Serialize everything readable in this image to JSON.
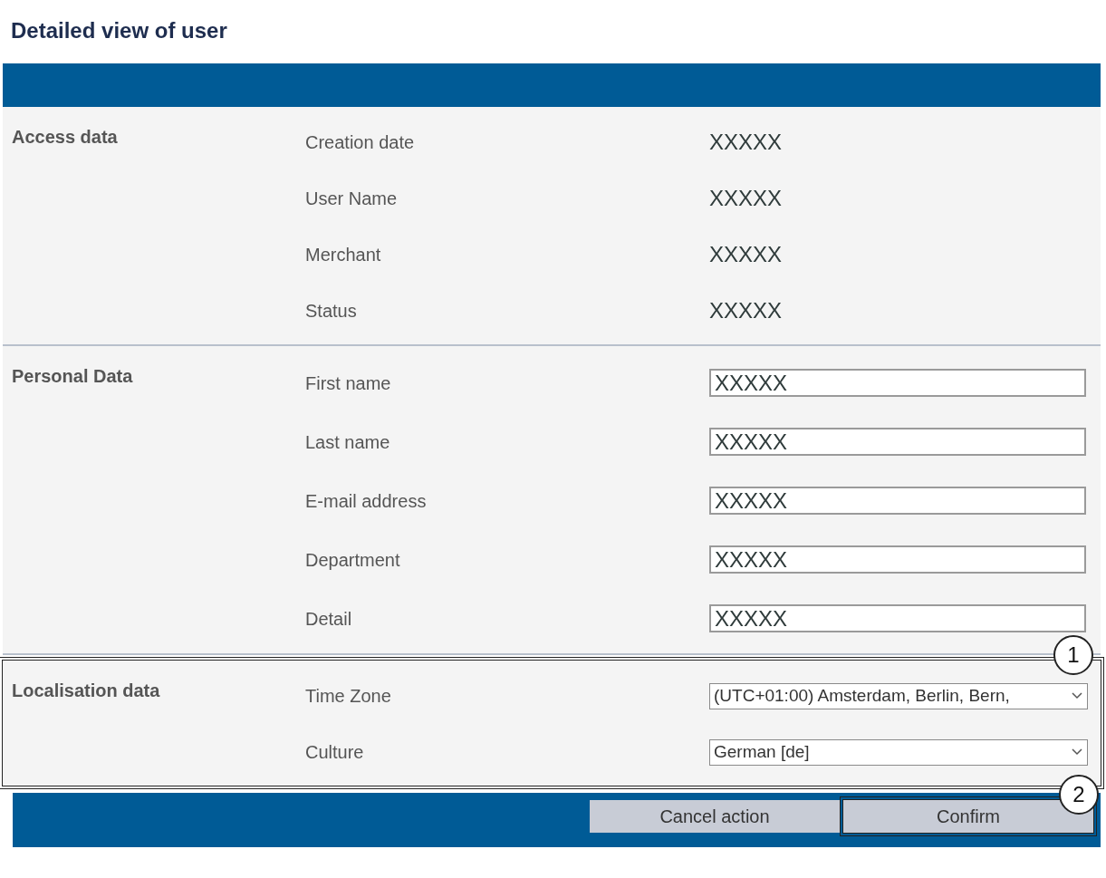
{
  "page": {
    "title": "Detailed view of user"
  },
  "sections": [
    {
      "title": "Access data",
      "highlighted": false,
      "rows": [
        {
          "label": "Creation date",
          "kind": "readonly",
          "value": "XXXXX"
        },
        {
          "label": "User Name",
          "kind": "readonly",
          "value": "XXXXX"
        },
        {
          "label": "Merchant",
          "kind": "readonly",
          "value": "XXXXX"
        },
        {
          "label": "Status",
          "kind": "readonly",
          "value": "XXXXX"
        }
      ]
    },
    {
      "title": "Personal Data",
      "highlighted": false,
      "rows": [
        {
          "label": "First name",
          "kind": "input",
          "value": "XXXXX"
        },
        {
          "label": "Last name",
          "kind": "input",
          "value": "XXXXX"
        },
        {
          "label": "E-mail address",
          "kind": "input",
          "value": "XXXXX"
        },
        {
          "label": "Department",
          "kind": "input",
          "value": "XXXXX"
        },
        {
          "label": "Detail",
          "kind": "input",
          "value": "XXXXX"
        }
      ]
    },
    {
      "title": "Localisation data",
      "highlighted": true,
      "callout": "1",
      "rows": [
        {
          "label": "Time Zone",
          "kind": "select",
          "value": "(UTC+01:00) Amsterdam, Berlin, Bern,"
        },
        {
          "label": "Culture",
          "kind": "select",
          "value": "German [de]"
        }
      ]
    }
  ],
  "buttons": [
    {
      "label": "Cancel action",
      "highlighted": false
    },
    {
      "label": "Confirm",
      "highlighted": true,
      "callout": "2"
    }
  ]
}
